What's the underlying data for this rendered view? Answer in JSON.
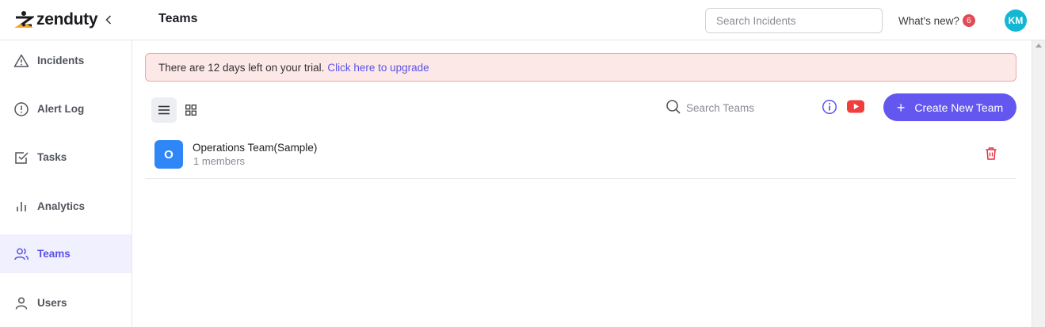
{
  "header": {
    "logo_text": "zenduty",
    "page_title": "Teams",
    "search_placeholder": "Search Incidents",
    "whats_new_label": "What's new?",
    "whats_new_count": "6",
    "avatar_initials": "KM"
  },
  "sidebar": {
    "items": [
      {
        "label": "Incidents",
        "icon": "warning-icon",
        "active": false
      },
      {
        "label": "Alert Log",
        "icon": "alert-circle-icon",
        "active": false
      },
      {
        "label": "Tasks",
        "icon": "checkbox-icon",
        "active": false
      },
      {
        "label": "Analytics",
        "icon": "bar-chart-icon",
        "active": false
      },
      {
        "label": "Teams",
        "icon": "users-icon",
        "active": true
      },
      {
        "label": "Users",
        "icon": "user-icon",
        "active": false
      }
    ]
  },
  "trial": {
    "message": "There are 12 days left on your trial.",
    "upgrade_link": "Click here to upgrade"
  },
  "toolbar": {
    "search_placeholder": "Search Teams",
    "create_label": "Create New Team"
  },
  "teams": [
    {
      "initial": "O",
      "name": "Operations Team(Sample)",
      "members": "1 members"
    }
  ],
  "colors": {
    "accent": "#6457f0",
    "active_nav_bg": "#f1f0fe",
    "trial_bg": "#fde8e8",
    "team_avatar": "#2f86f6",
    "delete": "#e0323f",
    "avatar": "#12b7d4"
  }
}
